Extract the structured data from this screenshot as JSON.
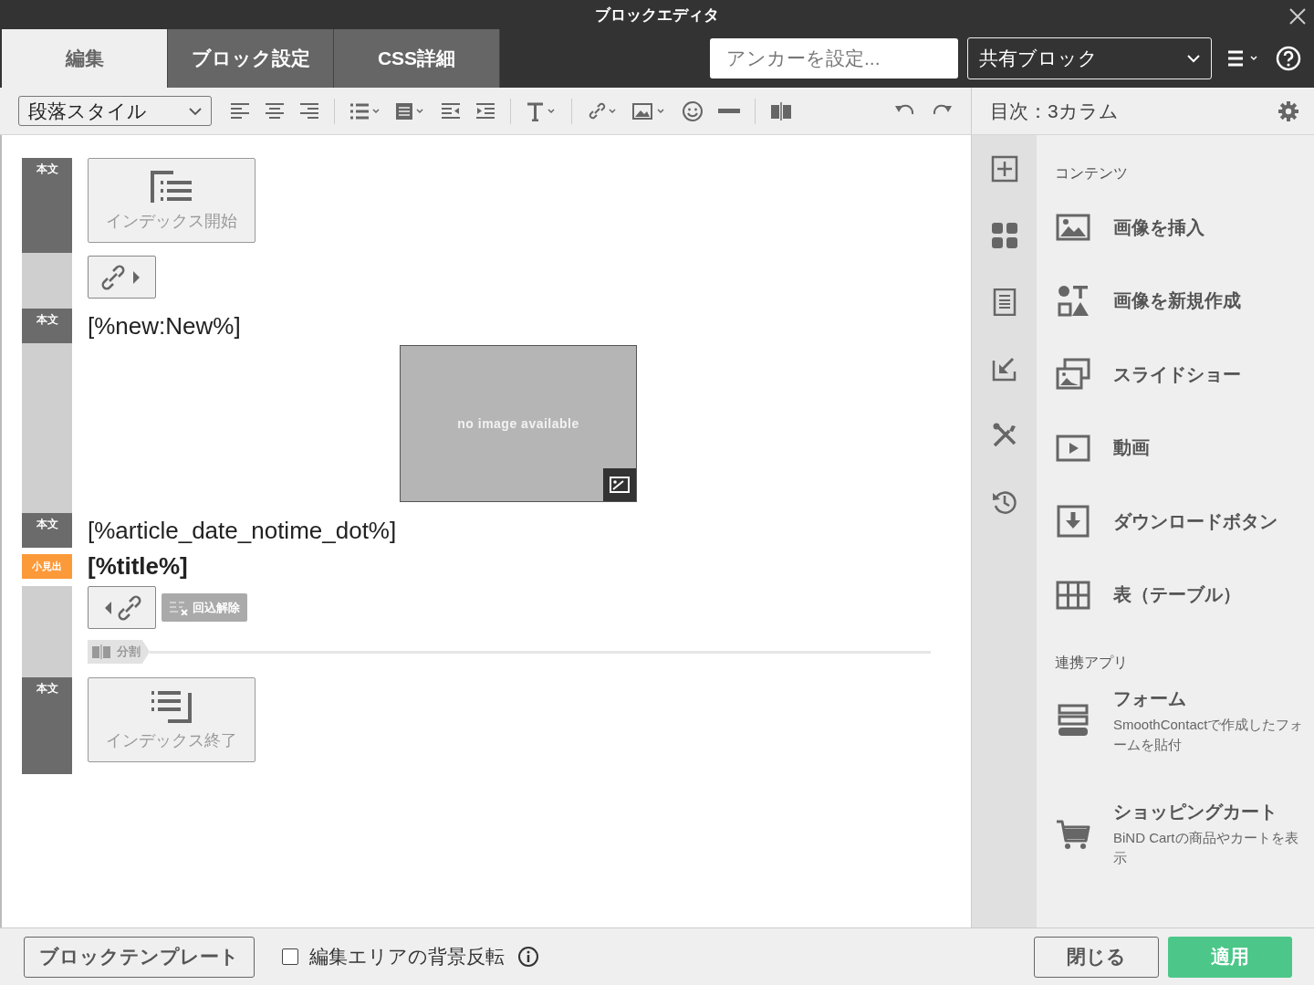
{
  "window": {
    "title": "ブロックエディタ"
  },
  "tabs": [
    {
      "label": "編集",
      "selected": true
    },
    {
      "label": "ブロック設定",
      "selected": false
    },
    {
      "label": "CSS詳細",
      "selected": false
    }
  ],
  "anchor_field": {
    "placeholder": "アンカーを設定..."
  },
  "block_select": {
    "value": "共有ブロック"
  },
  "toolbar": {
    "paragraph_style": "段落スタイル"
  },
  "panel": {
    "title": "目次：3カラム",
    "sections": [
      {
        "heading": "コンテンツ",
        "items": [
          {
            "label": "画像を挿入"
          },
          {
            "label": "画像を新規作成"
          },
          {
            "label": "スライドショー"
          },
          {
            "label": "動画"
          },
          {
            "label": "ダウンロードボタン"
          },
          {
            "label": "表（テーブル）"
          }
        ]
      },
      {
        "heading": "連携アプリ",
        "items": [
          {
            "label": "フォーム",
            "description": "SmoothContactで作成したフォームを貼付"
          },
          {
            "label": "ショッピングカート",
            "description": "BiND Cartの商品やカートを表示"
          }
        ]
      }
    ]
  },
  "blocks": [
    {
      "kind": "index_start",
      "label": "本文",
      "color": "#6b6b6b",
      "text": "インデックス開始"
    },
    {
      "kind": "link_next"
    },
    {
      "kind": "text",
      "label": "本文",
      "color": "#6b6b6b",
      "text": "[%new:New%]"
    },
    {
      "kind": "image",
      "text": "no image available"
    },
    {
      "kind": "text",
      "label": "本文",
      "color": "#6b6b6b",
      "text": "[%article_date_notime_dot%]"
    },
    {
      "kind": "heading",
      "label": "小見出",
      "color": "#fc9a3a",
      "text": "[%title%]"
    },
    {
      "kind": "link_prev",
      "chip": "回込解除",
      "divider": "分割"
    },
    {
      "kind": "index_end",
      "label": "本文",
      "color": "#6b6b6b",
      "text": "インデックス終了"
    }
  ],
  "footer": {
    "template_button": "ブロックテンプレート",
    "invert_checkbox": {
      "label": "編集エリアの背景反転",
      "checked": false
    },
    "close_button": "閉じる",
    "apply_button": "適用"
  }
}
